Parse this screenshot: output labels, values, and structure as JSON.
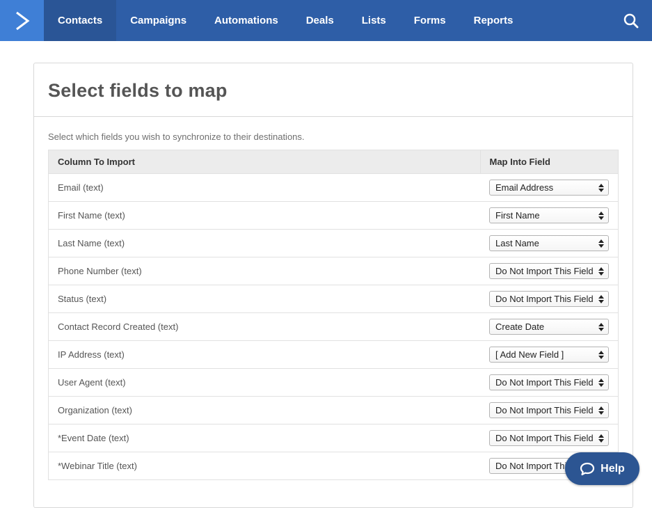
{
  "nav": {
    "logo_icon": "chevron-right-icon",
    "items": [
      {
        "label": "Contacts",
        "active": true
      },
      {
        "label": "Campaigns"
      },
      {
        "label": "Automations"
      },
      {
        "label": "Deals"
      },
      {
        "label": "Lists"
      },
      {
        "label": "Forms"
      },
      {
        "label": "Reports"
      }
    ],
    "search_icon": "search-icon"
  },
  "panel": {
    "title": "Select fields to map",
    "intro": "Select which fields you wish to synchronize to their destinations.",
    "columns": [
      "Column To Import",
      "Map Into Field"
    ],
    "rows": [
      {
        "column": "Email (text)",
        "field": "Email Address"
      },
      {
        "column": "First Name (text)",
        "field": "First Name"
      },
      {
        "column": "Last Name (text)",
        "field": "Last Name"
      },
      {
        "column": "Phone Number (text)",
        "field": "Do Not Import This Field"
      },
      {
        "column": "Status (text)",
        "field": "Do Not Import This Field"
      },
      {
        "column": "Contact Record Created (text)",
        "field": "Create Date"
      },
      {
        "column": "IP Address (text)",
        "field": "[ Add New Field ]"
      },
      {
        "column": "User Agent (text)",
        "field": "Do Not Import This Field"
      },
      {
        "column": "Organization (text)",
        "field": "Do Not Import This Field"
      },
      {
        "column": "*Event Date (text)",
        "field": "Do Not Import This Field"
      },
      {
        "column": "*Webinar Title (text)",
        "field": "Do Not Import This Field"
      }
    ]
  },
  "help": {
    "label": "Help",
    "icon": "chat-bubble-icon"
  },
  "colors": {
    "nav_bg": "#2e5ea7",
    "nav_active": "#2a5596",
    "logo_bg": "#3f7fd6",
    "help_bg": "#2c5592"
  }
}
